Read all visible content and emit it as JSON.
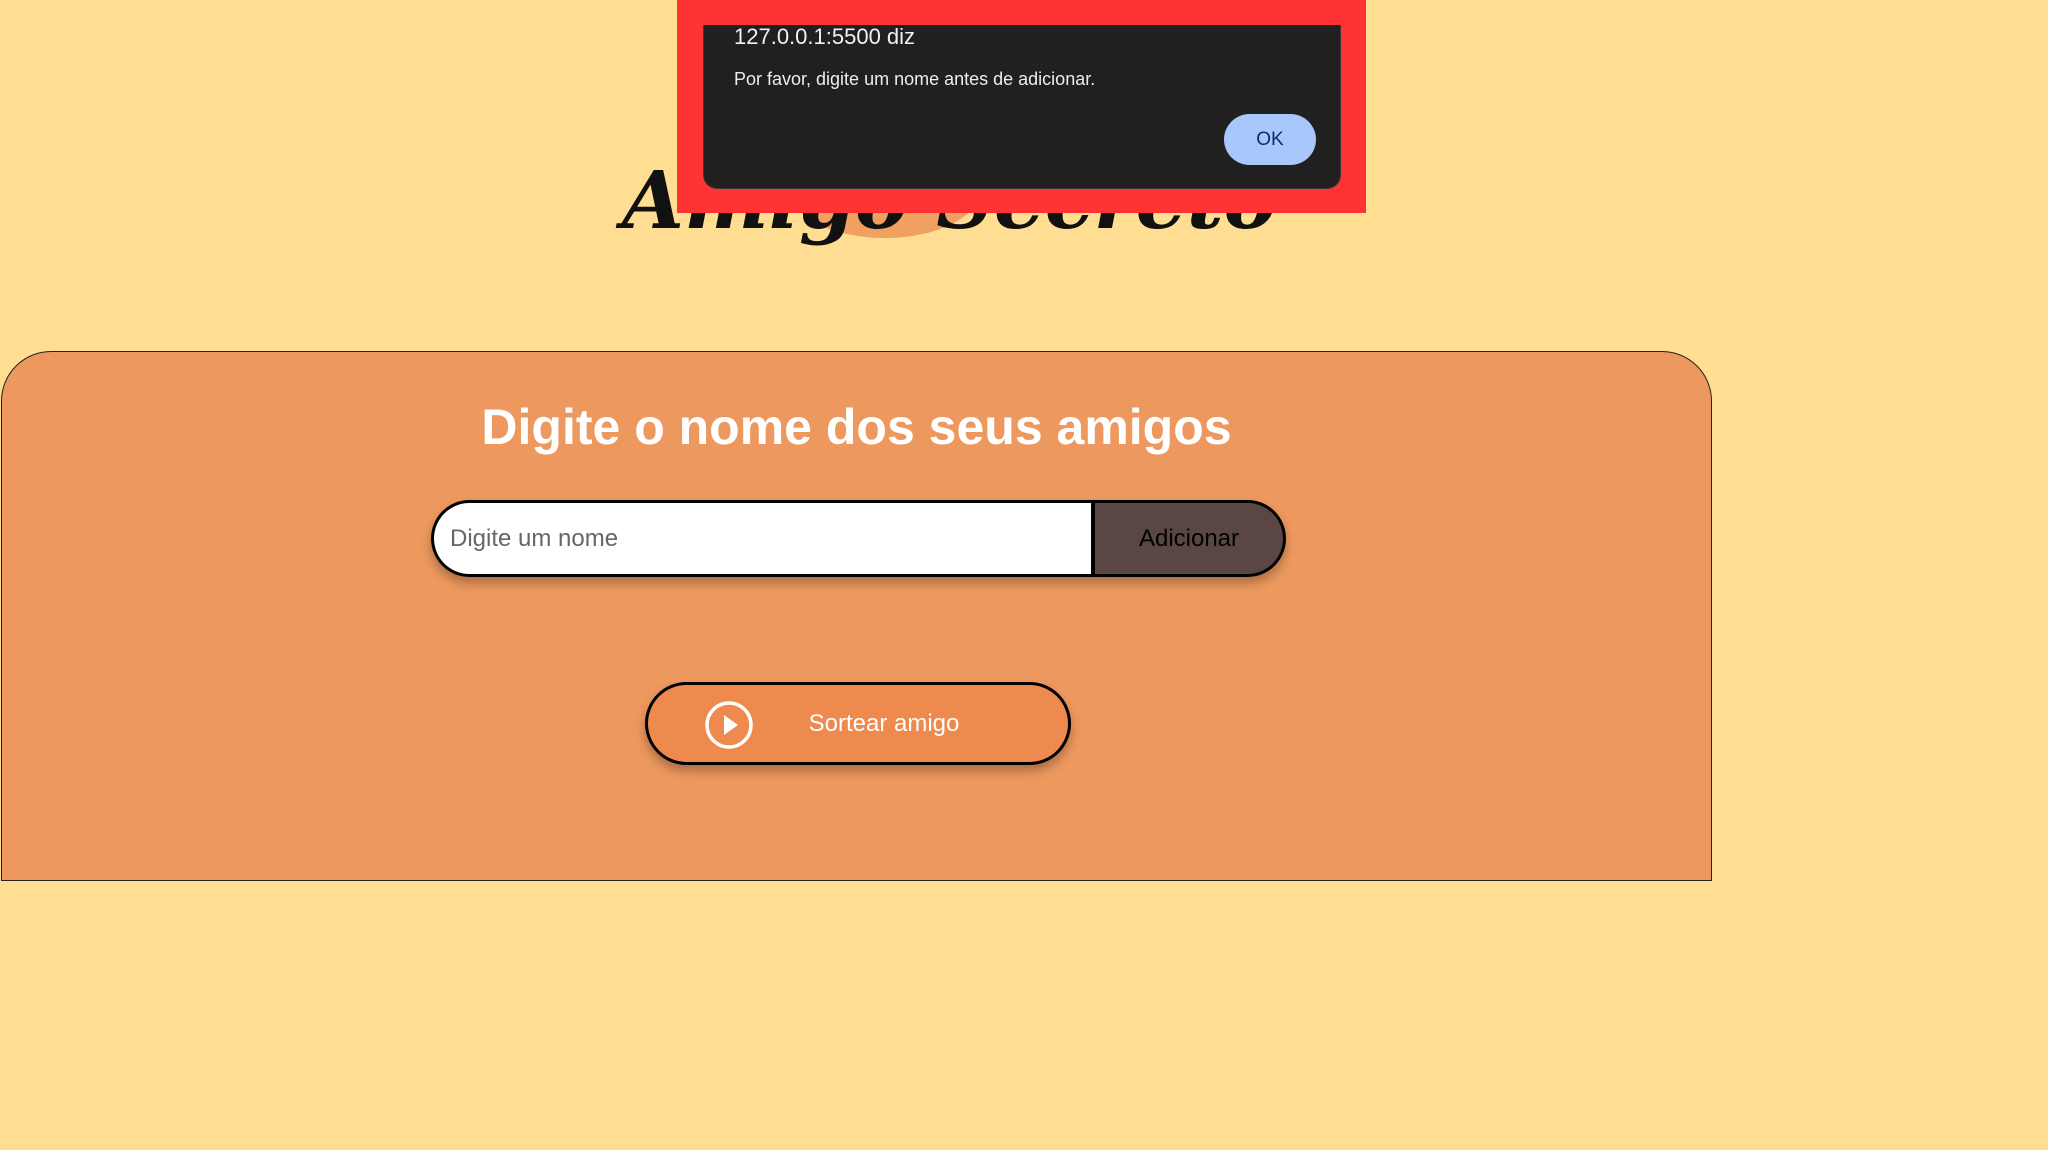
{
  "header": {
    "title": "Amigo Secreto"
  },
  "main": {
    "heading": "Digite o nome dos seus amigos",
    "name_input": {
      "placeholder": "Digite um nome",
      "value": ""
    },
    "add_button_label": "Adicionar",
    "draw_button_label": "Sortear amigo",
    "draw_icon": "play-circle-icon"
  },
  "alert": {
    "title": "127.0.0.1:5500 diz",
    "message": "Por favor, digite um nome antes de adicionar.",
    "ok_label": "OK"
  },
  "colors": {
    "page_background": "#FFDD93",
    "panel_background": "#ED985E",
    "add_button": "#5A4642",
    "draw_button": "#EE8A4D",
    "highlight": "#FF3333",
    "dialog_background": "#202020",
    "ok_button": "#A8C7FA"
  }
}
